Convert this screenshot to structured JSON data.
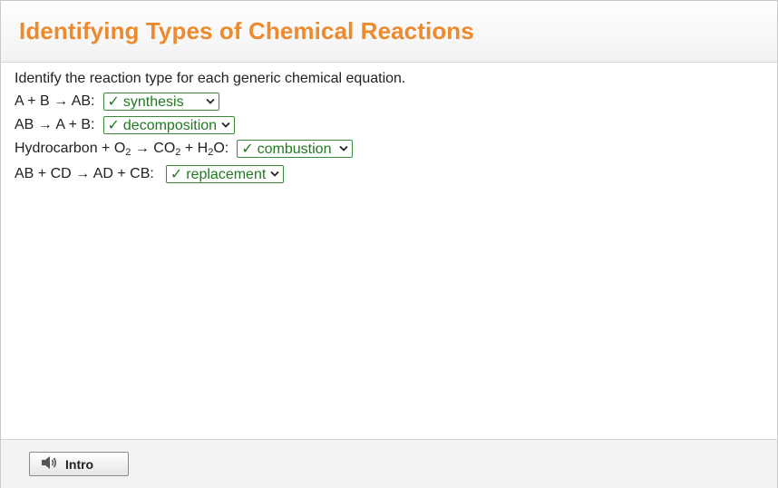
{
  "title": "Identifying Types of Chemical Reactions",
  "instructions": "Identify the reaction type for each generic chemical equation.",
  "rows": [
    {
      "eq_text": "A + B → AB:",
      "selected": "synthesis",
      "check": "✓"
    },
    {
      "eq_text": "AB → A + B:",
      "selected": "decomposition",
      "check": "✓"
    },
    {
      "eq_parts": [
        "Hydrocarbon + O",
        "2",
        " → CO",
        "2",
        " + H",
        "2",
        "O:"
      ],
      "selected": "combustion",
      "check": "✓"
    },
    {
      "eq_text": "AB + CD → AD + CB:",
      "selected": "replacement",
      "check": "✓"
    }
  ],
  "footer": {
    "intro_label": "Intro",
    "intro_icon": "speaker-icon"
  },
  "colors": {
    "title": "#ee8a2e",
    "correct": "#1f7a1f",
    "correct_border": "#3a8c3a"
  }
}
